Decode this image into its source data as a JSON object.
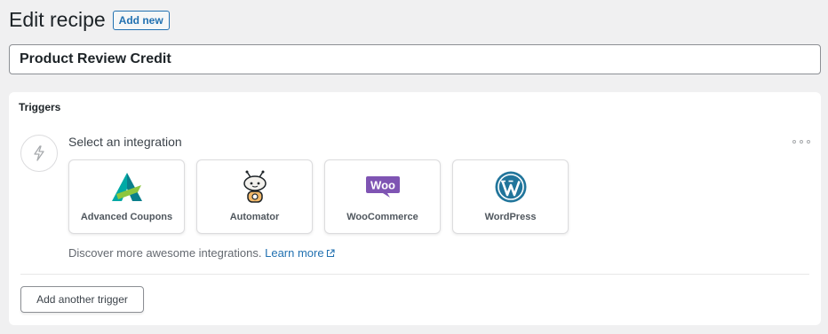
{
  "header": {
    "title": "Edit recipe",
    "add_new_label": "Add new"
  },
  "recipe": {
    "title": "Product Review Credit"
  },
  "triggers": {
    "heading": "Triggers",
    "select_label": "Select an integration",
    "more_icon": "ellipsis-icon",
    "bolt_icon": "lightning-bolt-icon",
    "integrations": [
      {
        "name": "Advanced Coupons",
        "icon": "advanced-coupons-logo-icon"
      },
      {
        "name": "Automator",
        "icon": "automator-robot-icon"
      },
      {
        "name": "WooCommerce",
        "icon": "woocommerce-logo-icon",
        "logo_text": "Woo"
      },
      {
        "name": "WordPress",
        "icon": "wordpress-logo-icon"
      }
    ],
    "discover_text": "Discover more awesome integrations.",
    "learn_more_label": "Learn more",
    "add_trigger_label": "Add another trigger"
  },
  "colors": {
    "background": "#f0f0f1",
    "accent_blue": "#2271b1",
    "woo_purple": "#7f54b3",
    "wordpress_blue": "#21759b",
    "advanced_coupons_teal": "#00a9a5",
    "advanced_coupons_green": "#8cc63f"
  }
}
